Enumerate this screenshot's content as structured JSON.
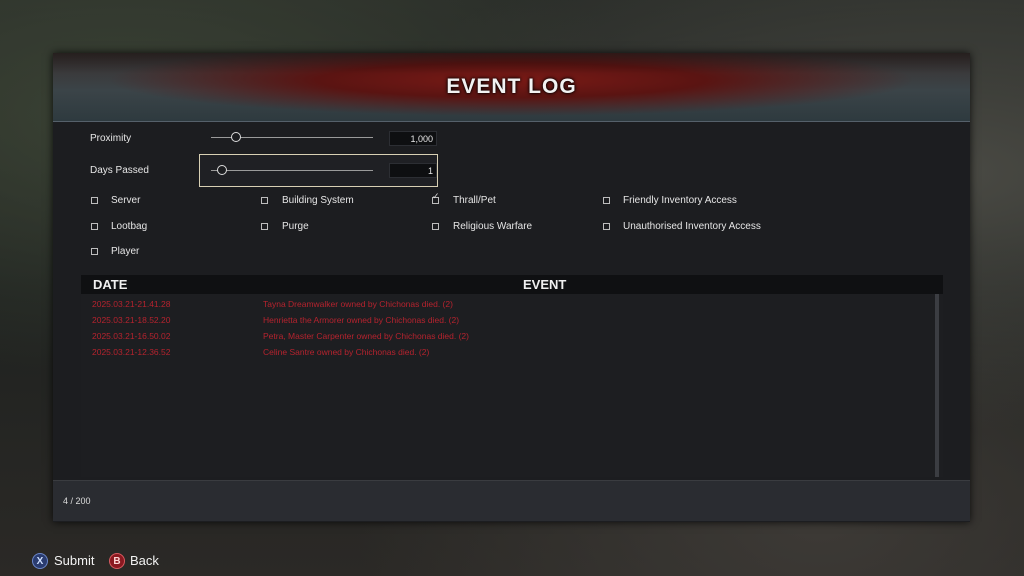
{
  "window": {
    "title": "EVENT LOG"
  },
  "filters": {
    "proximity": {
      "label": "Proximity",
      "value": "1,000"
    },
    "days_passed": {
      "label": "Days Passed",
      "value": "1"
    }
  },
  "categories": [
    {
      "label": "Server",
      "checked": false
    },
    {
      "label": "Building System",
      "checked": false
    },
    {
      "label": "Thrall/Pet",
      "checked": true
    },
    {
      "label": "Friendly Inventory Access",
      "checked": false
    },
    {
      "label": "Lootbag",
      "checked": false
    },
    {
      "label": "Purge",
      "checked": false
    },
    {
      "label": "Religious Warfare",
      "checked": false
    },
    {
      "label": "Unauthorised Inventory Access",
      "checked": false
    },
    {
      "label": "Player",
      "checked": false
    }
  ],
  "table": {
    "columns": {
      "date": "DATE",
      "event": "EVENT"
    },
    "rows": [
      {
        "date": "2025.03.21-21.41.28",
        "event": "Tayna Dreamwalker owned by Chichonas died. (2)"
      },
      {
        "date": "2025.03.21-18.52.20",
        "event": "Henrietta the Armorer owned by Chichonas died. (2)"
      },
      {
        "date": "2025.03.21-16.50.02",
        "event": "Petra, Master Carpenter owned by Chichonas died. (2)"
      },
      {
        "date": "2025.03.21-12.36.52",
        "event": "Celine Santre owned by Chichonas died. (2)"
      }
    ]
  },
  "footer": {
    "count": "4 / 200"
  },
  "controls": {
    "submit": {
      "glyph": "X",
      "label": "Submit"
    },
    "back": {
      "glyph": "B",
      "label": "Back"
    }
  },
  "colors": {
    "event_text": "#b5232e",
    "header_accent": "#7a1a16"
  }
}
